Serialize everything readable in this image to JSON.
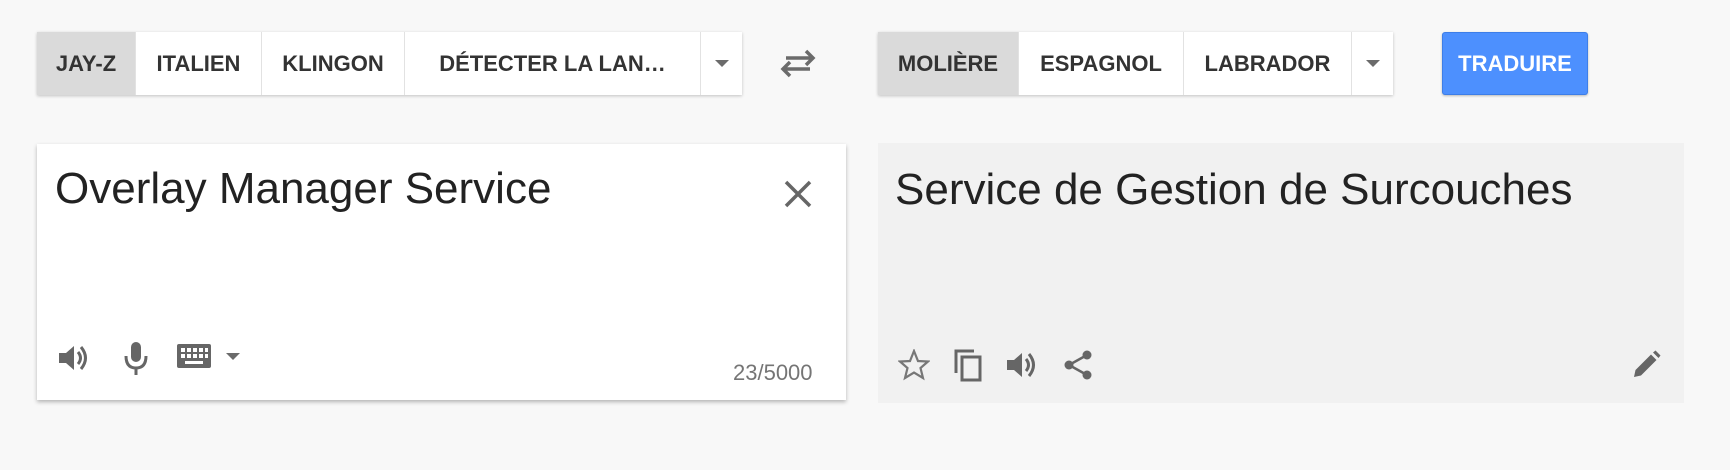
{
  "source_languages": {
    "items": [
      {
        "label": "JAY-Z",
        "active": true
      },
      {
        "label": "ITALIEN",
        "active": false
      },
      {
        "label": "KLINGON",
        "active": false
      },
      {
        "label": "DÉTECTER LA LAN…",
        "active": false
      }
    ],
    "dropdown_icon": "chevron-down-icon"
  },
  "target_languages": {
    "items": [
      {
        "label": "MOLIÈRE",
        "active": true
      },
      {
        "label": "ESPAGNOL",
        "active": false
      },
      {
        "label": "LABRADOR",
        "active": false
      }
    ],
    "dropdown_icon": "chevron-down-icon"
  },
  "swap_icon": "swap-icon",
  "translate_button": {
    "label": "TRADUIRE",
    "color": "#4d90fe"
  },
  "source": {
    "text": "Overlay Manager Service",
    "char_count": "23/5000",
    "icons": [
      "speaker-icon",
      "microphone-icon",
      "keyboard-icon",
      "chevron-down-icon",
      "close-icon"
    ]
  },
  "translation": {
    "text": "Service de Gestion de Surcouches",
    "icons": [
      "star-icon",
      "copy-icon",
      "speaker-icon",
      "share-icon",
      "pencil-icon"
    ]
  },
  "colors": {
    "accent": "#4d90fe",
    "active_tab": "#dadada",
    "output_bg": "#f1f1f1"
  }
}
